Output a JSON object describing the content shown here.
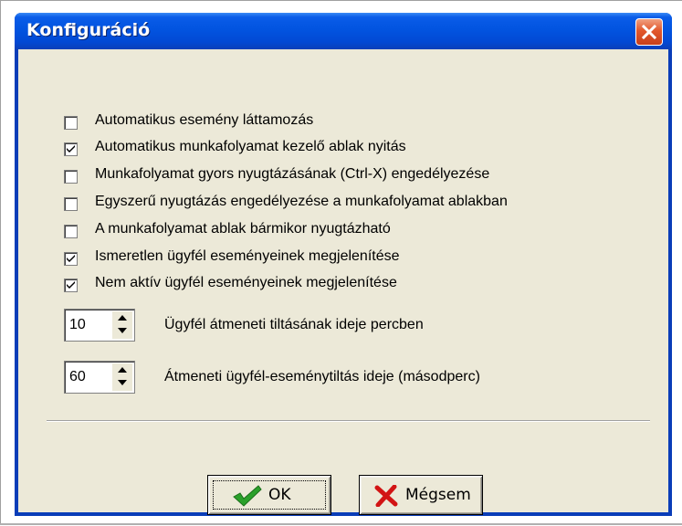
{
  "window": {
    "title": "Konfiguráció",
    "close_icon": "close-icon"
  },
  "options": [
    {
      "label": "Automatikus esemény láttamozás",
      "checked": false
    },
    {
      "label": "Automatikus munkafolyamat kezelő ablak nyitás",
      "checked": true
    },
    {
      "label": "Munkafolyamat gyors nyugtázásának (Ctrl-X) engedélyezése",
      "checked": false
    },
    {
      "label": "Egyszerű nyugtázás engedélyezése a munkafolyamat ablakban",
      "checked": false
    },
    {
      "label": "A munkafolyamat ablak bármikor nyugtázható",
      "checked": false
    },
    {
      "label": "Ismeretlen ügyfél eseményeinek megjelenítése",
      "checked": true
    },
    {
      "label": "Nem aktív ügyfél eseményeinek megjelenítése",
      "checked": true
    }
  ],
  "spinners": [
    {
      "value": "10",
      "label": "Ügyfél átmeneti tiltásának ideje percben"
    },
    {
      "value": "60",
      "label": "Átmeneti ügyfél-eseménytiltás ideje (másodperc)"
    }
  ],
  "buttons": {
    "ok_label": "OK",
    "cancel_label": "Mégsem"
  },
  "colors": {
    "titlebar": "#0254e0",
    "dialog_bg": "#ece9d8",
    "ok_icon": "#2aa02a",
    "cancel_icon": "#d21414"
  }
}
